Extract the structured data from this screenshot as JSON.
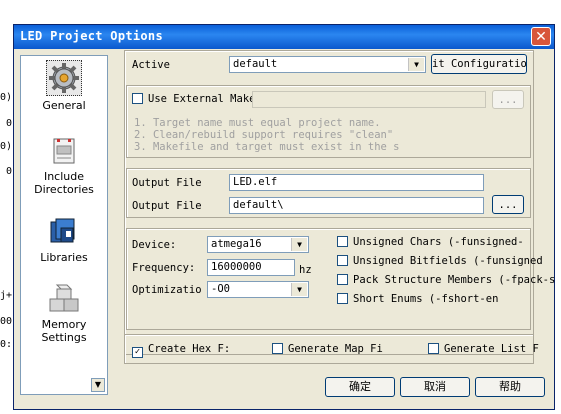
{
  "background": {
    "fragments": [
      "0)",
      "0'",
      "0)",
      "0'",
      "j+",
      "00",
      "0:"
    ]
  },
  "window": {
    "title": "LED Project Options",
    "close_glyph": "✕"
  },
  "sidebar": {
    "items": [
      {
        "label": "General",
        "icon": "gear-icon"
      },
      {
        "label": "Include\nDirectories",
        "icon": "folder-icon"
      },
      {
        "label": "Libraries",
        "icon": "books-icon"
      },
      {
        "label": "Memory\nSettings",
        "icon": "cubes-icon"
      }
    ],
    "scroll_glyph": "▼"
  },
  "general": {
    "active_label": "Active",
    "active_value": "default",
    "edit_config_label": "it Configuratio",
    "use_external_makefile_label": "Use External Makef",
    "browse_label": "...",
    "hints": [
      "1. Target name must equal project name.",
      "2. Clean/rebuild support requires \"clean\"",
      "3. Makefile and target must exist in the s"
    ],
    "output_file_label": "Output File",
    "output_file_value": "LED.elf",
    "output_dir_label": "Output File",
    "output_dir_value": "default\\",
    "output_dir_browse": "...",
    "device_label": "Device:",
    "device_value": "atmega16",
    "frequency_label": "Frequency:",
    "frequency_value": "16000000",
    "frequency_unit": "hz",
    "optimization_label": "Optimizatio",
    "optimization_value": "-O0",
    "options": [
      {
        "label": "Unsigned Chars (-funsigned-",
        "checked": false
      },
      {
        "label": "Unsigned Bitfields (-funsigned",
        "checked": false
      },
      {
        "label": "Pack Structure Members (-fpack-s",
        "checked": false
      },
      {
        "label": "Short Enums (-fshort-en",
        "checked": false
      }
    ],
    "create_hex_label": "Create Hex F:",
    "generate_map_label": "Generate Map Fi",
    "generate_list_label": "Generate List F"
  },
  "buttons": {
    "ok": "确定",
    "cancel": "取消",
    "help": "帮助"
  },
  "colors": {
    "titlebar": "#0b58cd",
    "dialog": "#ece9d8",
    "close": "#d8563b"
  }
}
